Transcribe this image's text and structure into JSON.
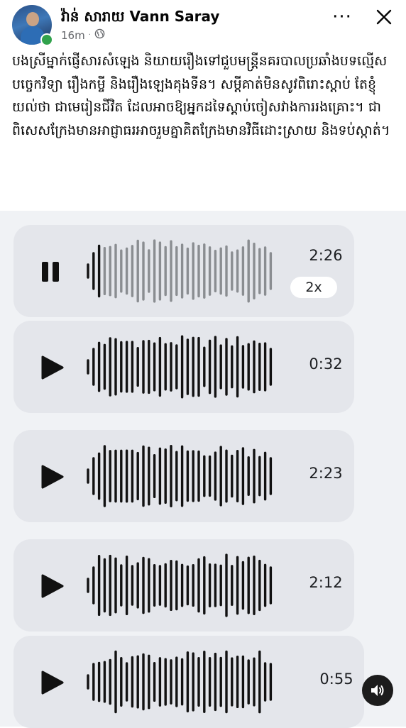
{
  "header": {
    "author": "វ៉ាន់ សារាយ  Vann Saray",
    "timestamp": "16m",
    "separator": "·",
    "privacy_icon": "globe-icon",
    "more_label": "···",
    "close_icon": "close-icon"
  },
  "post": {
    "text": "បងស្រីម្នាក់ផ្ញើសារសំឡេង និយាយរឿងទៅជួបមន្ត្រីនគរបាលប្រឆាំងបទល្មើសបច្ចេកវិទ្យា រឿងកម្ចី និងរឿងឡេងគុងទីន។ សម្ដីគាត់មិនសូវពិរោះស្ដាប់ តែខ្ញុំយល់ថា ជាមេរៀនជីវិត ដែលអាចឱ្យអ្នកដទៃស្ដាប់ចៀសវាងការរងគ្រោះ។ ជាពិសេសក្រែងមានអាជ្ញាធរអាចរួមគ្នាគិតក្រែងមានវិធីដោះស្រាយ និងទប់ស្កាត់។"
  },
  "audio_messages": [
    {
      "duration": "2:26",
      "state": "playing",
      "speed": "2x",
      "control_icon": "pause-icon"
    },
    {
      "duration": "0:32",
      "state": "paused",
      "control_icon": "play-icon"
    },
    {
      "duration": "2:23",
      "state": "paused",
      "control_icon": "play-icon"
    },
    {
      "duration": "2:12",
      "state": "paused",
      "control_icon": "play-icon"
    },
    {
      "duration": "0:55",
      "state": "paused",
      "control_icon": "play-icon"
    }
  ],
  "sound_button_icon": "speaker-icon",
  "colors": {
    "background": "#ffffff",
    "attachment_bg": "#f0f2f5",
    "card_bg": "#e4e6eb",
    "waveform_active": "#111111",
    "waveform_played": "#8a8d91",
    "online": "#31a24c",
    "meta_text": "#65676b"
  }
}
